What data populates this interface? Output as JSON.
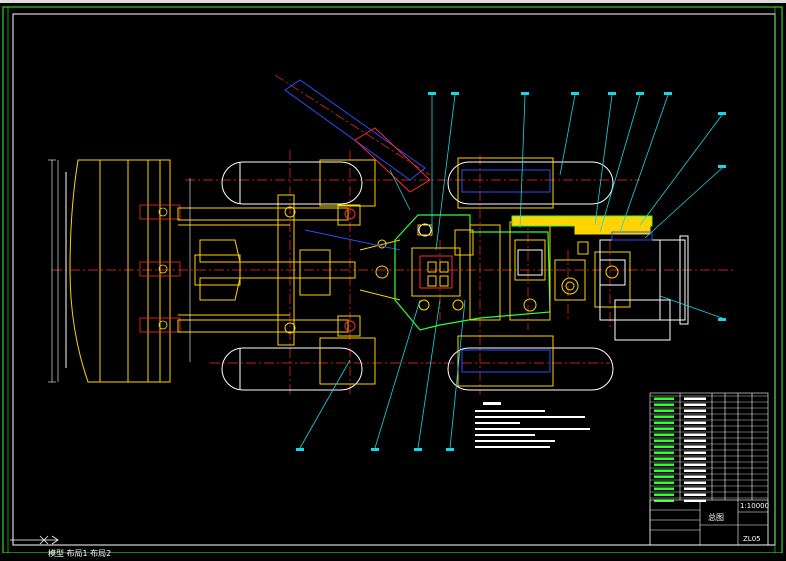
{
  "drawing": {
    "title_block": {
      "drawing_name": "总图",
      "drawing_code": "ZL05",
      "scale_line": "1:10000"
    },
    "taskbar_text": "模型 布局1 布局2"
  },
  "colors": {
    "background": "#000000",
    "frame": "#30ff30",
    "outline": "#ffffff",
    "yellow": "#ffd400",
    "red": "#ff2b2b",
    "blue": "#2b4bff",
    "cyan": "#19d6e6",
    "green": "#30ff30"
  }
}
